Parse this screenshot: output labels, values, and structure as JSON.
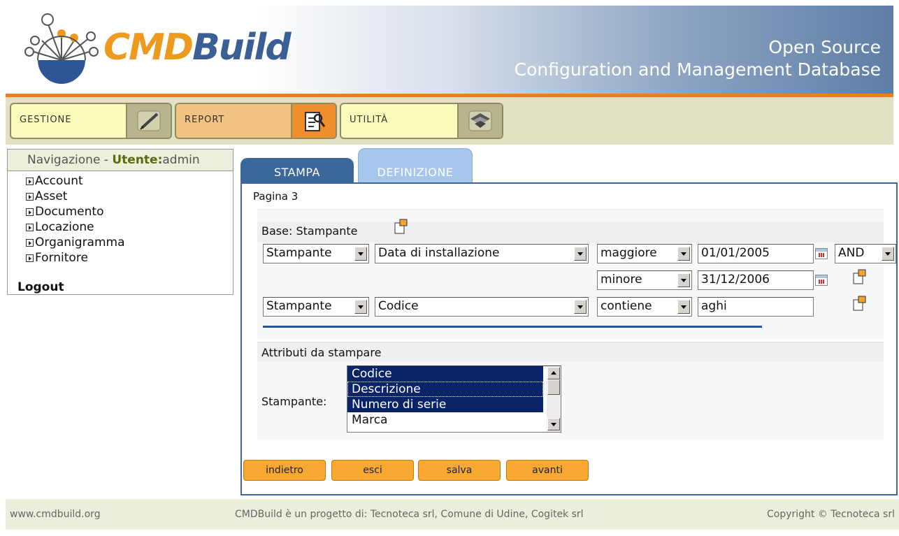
{
  "header": {
    "logo_cmd": "CMD",
    "logo_build": "Build",
    "tagline_line1": "Open Source",
    "tagline_line2": "Configuration and Management Database"
  },
  "menu": {
    "gestione": "GESTIONE",
    "report": "REPORT",
    "utilita": "UTILITÀ"
  },
  "navigation": {
    "title_prefix": "Navigazione - ",
    "user_label": "Utente:",
    "user_name": "admin",
    "items": [
      "Account",
      "Asset",
      "Documento",
      "Locazione",
      "Organigramma",
      "Fornitore"
    ],
    "logout": "Logout"
  },
  "tabs": {
    "stampa": "STAMPA",
    "definizione": "DEFINIZIONE"
  },
  "panel": {
    "page_label": "Pagina 3",
    "base_label": "Base: Stampante",
    "filters": {
      "row1": {
        "entity": "Stampante",
        "attribute": "Data di installazione",
        "operator": "maggiore",
        "value": "01/01/2005",
        "logic": "AND"
      },
      "row2": {
        "operator": "minore",
        "value": "31/12/2006"
      },
      "row3": {
        "entity": "Stampante",
        "attribute": "Codice",
        "operator": "contiene",
        "value": "aghi"
      }
    },
    "attributes_title": "Attributi da stampare",
    "stampante_label": "Stampante:",
    "attribute_options": [
      "Codice",
      "Descrizione",
      "Numero di serie",
      "Marca"
    ],
    "buttons": {
      "indietro": "indietro",
      "esci": "esci",
      "salva": "salva",
      "avanti": "avanti"
    }
  },
  "footer": {
    "left": "www.cmdbuild.org",
    "center": "CMDBuild è un progetto di: Tecnoteca srl, Comune di Udine, Cogitek srl",
    "right": "Copyright © Tecnoteca srl"
  },
  "icons": {
    "logo": "cmdbuild-logo-icon",
    "gestione": "pen-icon",
    "report": "report-search-icon",
    "utilita": "layers-icon",
    "add_filter": "add-document-icon",
    "calendar": "calendar-icon"
  },
  "colors": {
    "accent_orange": "#ee7e1e",
    "tab_blue": "#3b679b",
    "button_orange": "#f7a832"
  }
}
